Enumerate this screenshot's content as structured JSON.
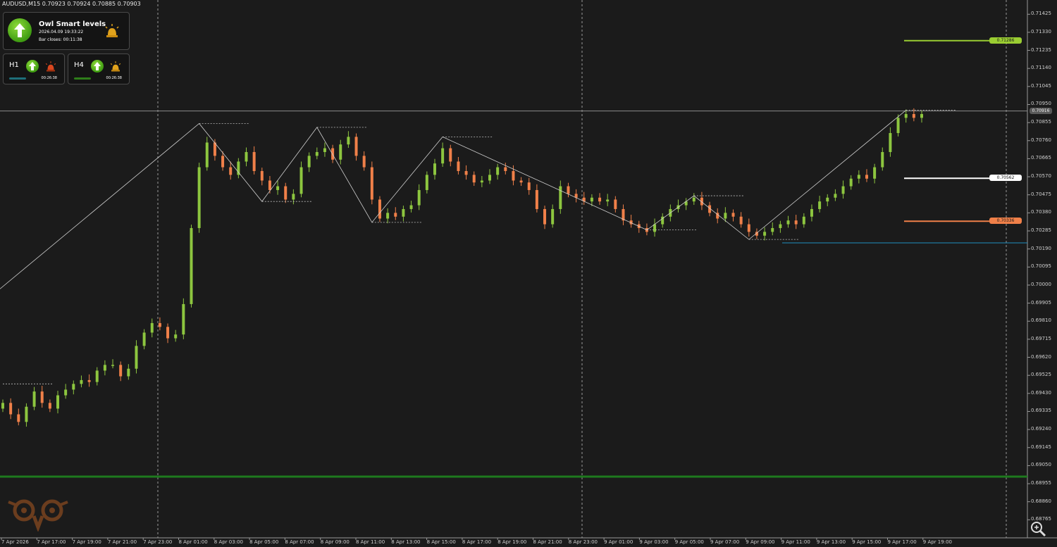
{
  "header": {
    "symbol_info": "AUDUSD,M15  0.70923 0.70924 0.70885 0.70903"
  },
  "panel": {
    "title": "Owl Smart levels",
    "datetime": "2026.04.09 19:33:22",
    "bar_closes": "Bar closes: 00:11:38",
    "signal_icon": "arrow-up-icon",
    "alert_icon": "siren-icon",
    "timeframes": [
      {
        "label": "H1",
        "timer": "00:26:38",
        "alert_color": "#d9471f",
        "bar_color": "#1e6f7a"
      },
      {
        "label": "H4",
        "timer": "00:26:38",
        "alert_color": "#e0a21c",
        "bar_color": "#2e7d1a"
      }
    ]
  },
  "colors": {
    "background": "#1b1b1b",
    "bull": "#8dc63f",
    "bear": "#f08049",
    "level_green": "#9acd32",
    "level_white": "#ffffff",
    "level_orange": "#f08049",
    "level_blue": "#1f8fbf",
    "support_dark_green": "#1e7a1e"
  },
  "levels": [
    {
      "name": "upper-green",
      "price": 0.71286,
      "label": "0.71286"
    },
    {
      "name": "current",
      "price": 0.70916,
      "label": "0.70916"
    },
    {
      "name": "mid-white",
      "price": 0.70562,
      "label": "0.70562"
    },
    {
      "name": "lower-orange",
      "price": 0.70336,
      "label": "0.70336"
    }
  ],
  "chart_data": {
    "type": "candlestick",
    "symbol": "AUDUSD",
    "timeframe": "M15",
    "ylim": [
      0.6867,
      0.715
    ],
    "y_ticks": [
      "0.71425",
      "0.71330",
      "0.71235",
      "0.71140",
      "0.71045",
      "0.70950",
      "0.70855",
      "0.70760",
      "0.70665",
      "0.70570",
      "0.70475",
      "0.70380",
      "0.70285",
      "0.70190",
      "0.70095",
      "0.70000",
      "0.69905",
      "0.69810",
      "0.69715",
      "0.69620",
      "0.69525",
      "0.69430",
      "0.69335",
      "0.69240",
      "0.69145",
      "0.69050",
      "0.68955",
      "0.68860",
      "0.68765"
    ],
    "x_ticks": [
      "7 Apr 2026",
      "7 Apr 17:00",
      "7 Apr 19:00",
      "7 Apr 21:00",
      "7 Apr 23:00",
      "8 Apr 01:00",
      "8 Apr 03:00",
      "8 Apr 05:00",
      "8 Apr 07:00",
      "8 Apr 09:00",
      "8 Apr 11:00",
      "8 Apr 13:00",
      "8 Apr 15:00",
      "8 Apr 17:00",
      "8 Apr 19:00",
      "8 Apr 21:00",
      "8 Apr 23:00",
      "9 Apr 01:00",
      "9 Apr 03:00",
      "9 Apr 05:00",
      "9 Apr 07:00",
      "9 Apr 09:00",
      "9 Apr 11:00",
      "9 Apr 13:00",
      "9 Apr 15:00",
      "9 Apr 17:00",
      "9 Apr 19:00"
    ],
    "close_path": [
      0.6938,
      0.6932,
      0.6928,
      0.6936,
      0.6944,
      0.6938,
      0.6935,
      0.6942,
      0.6945,
      0.6948,
      0.695,
      0.6949,
      0.6955,
      0.6958,
      0.6958,
      0.6952,
      0.6956,
      0.6968,
      0.6975,
      0.698,
      0.6978,
      0.6972,
      0.6974,
      0.699,
      0.703,
      0.7062,
      0.7075,
      0.7068,
      0.7062,
      0.7058,
      0.7065,
      0.707,
      0.706,
      0.7055,
      0.705,
      0.7052,
      0.7045,
      0.7048,
      0.7062,
      0.7068,
      0.707,
      0.7072,
      0.7066,
      0.7074,
      0.7078,
      0.7068,
      0.7062,
      0.7045,
      0.7035,
      0.7038,
      0.7036,
      0.704,
      0.7042,
      0.705,
      0.7058,
      0.7064,
      0.7072,
      0.7065,
      0.706,
      0.7058,
      0.7054,
      0.7055,
      0.7058,
      0.7062,
      0.706,
      0.7055,
      0.7054,
      0.705,
      0.704,
      0.7032,
      0.704,
      0.7052,
      0.7048,
      0.7046,
      0.7044,
      0.7046,
      0.7044,
      0.7045,
      0.704,
      0.7034,
      0.7032,
      0.703,
      0.7028,
      0.7032,
      0.7036,
      0.704,
      0.7042,
      0.7044,
      0.7046,
      0.7042,
      0.7038,
      0.7035,
      0.7038,
      0.7036,
      0.7032,
      0.7028,
      0.7026,
      0.7028,
      0.703,
      0.7032,
      0.7034,
      0.7032,
      0.7036,
      0.704,
      0.7044,
      0.7046,
      0.7048,
      0.7052,
      0.7056,
      0.7058,
      0.7056,
      0.7062,
      0.707,
      0.708,
      0.7088,
      0.709,
      0.7088,
      0.709
    ]
  }
}
